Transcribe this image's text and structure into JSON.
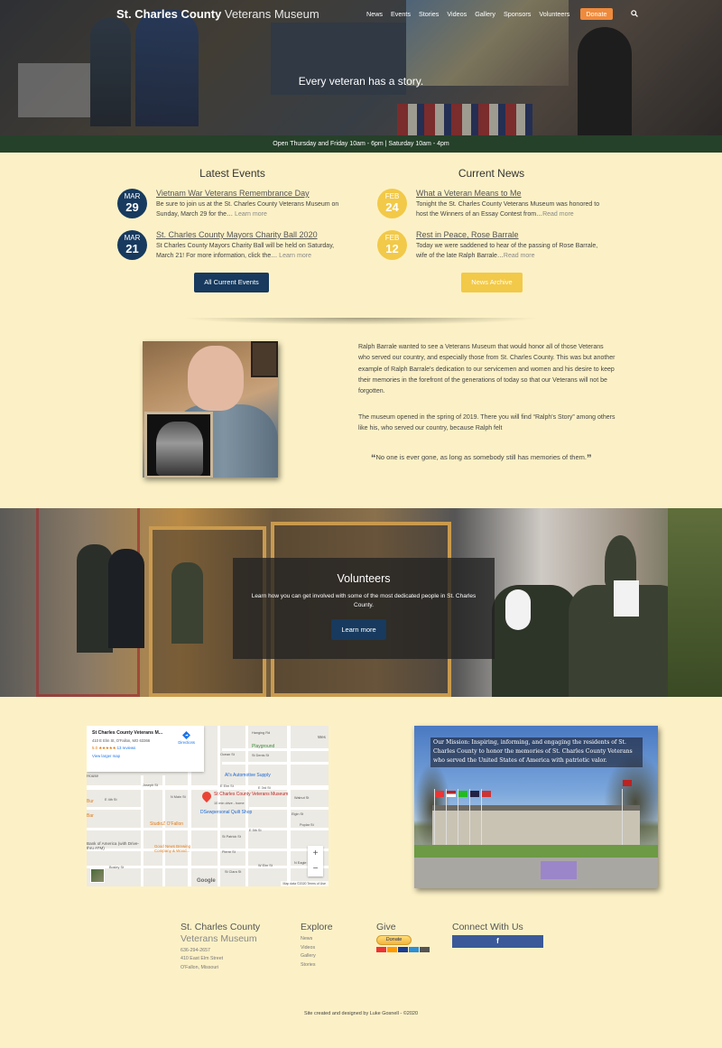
{
  "header": {
    "brand_bold": "St. Charles County",
    "brand_light": "Veterans Museum",
    "nav": [
      "News",
      "Events",
      "Stories",
      "Videos",
      "Gallery",
      "Sponsors",
      "Volunteers"
    ],
    "donate": "Donate",
    "search_icon": "search-icon",
    "tagline": "Every veteran has a story.",
    "hours": "Open Thursday and Friday 10am - 6pm | Saturday 10am - 4pm"
  },
  "events": {
    "title": "Latest Events",
    "items": [
      {
        "month": "MAR",
        "day": "29",
        "title": "Vietnam War Veterans Remembrance Day",
        "text": "Be sure to join us at the St. Charles County Veterans Museum on Sunday, March 29 for the…",
        "more": "Learn more"
      },
      {
        "month": "MAR",
        "day": "21",
        "title": "St. Charles County Mayors Charity Ball 2020",
        "text": "St Charles County Mayors Charity Ball will be held on Saturday, March 21! For more information, click the…",
        "more": "Learn more"
      }
    ],
    "button": "All Current Events"
  },
  "news": {
    "title": "Current News",
    "items": [
      {
        "month": "FEB",
        "day": "24",
        "title": "What a Veteran Means to Me",
        "text": "Tonight the St. Charles County Veterans Museum was honored to host the Winners of an Essay Contest from…",
        "more": "Read more"
      },
      {
        "month": "FEB",
        "day": "12",
        "title": "Rest in Peace, Rose Barrale",
        "text": "Today we were saddened to hear of the passing of Rose Barrale, wife of the late Ralph Barrale…",
        "more": "Read more"
      }
    ],
    "button": "News Archive"
  },
  "about": {
    "p1": "Ralph Barrale wanted to see a Veterans Museum that would honor all of those Veterans who served our country, and especially those from St. Charles County. This was but another example of Ralph Barrale's dedication to our servicemen and women and his desire to keep their memories in the forefront of the generations of today so that our Veterans will not be forgotten.",
    "p2": "The museum opened in the spring of 2019. There you will find “Ralph's Story” among others like his, who served our country, because Ralph felt",
    "quote": "No one is ever gone, as long as somebody still has memories of them."
  },
  "volunteers": {
    "title": "Volunteers",
    "text": "Learn how you can get involved with some of the most dedicated people in St. Charles County.",
    "button": "Learn more"
  },
  "map": {
    "name": "St Charles County Veterans M...",
    "address": "410 E Elm St, O'Fallon, MO 63366",
    "rating": "5.0",
    "stars": "★★★★★",
    "reviews": "13 reviews",
    "larger": "View larger map",
    "directions": "Directions",
    "labels": {
      "playground": "Playground",
      "al": "Al's Automotive Supply",
      "marker": "St Charles County Veterans Museum",
      "marker_sub": "10 min drive - home",
      "quilt": "DSewpersonal Quilt Shop",
      "studio": "StudioZ O'Fallon",
      "bank": "Bank of America (with Drive-thru ATM)",
      "brewing": "Good News Brewing Company & Wood...",
      "house": "House",
      "bar": "Bar",
      "bur": "Bur",
      "elm": "E Elm St",
      "main": "N Main St",
      "joseph": "Joseph St",
      "third": "E 3rd St",
      "fourth": "E 4th St",
      "fifth": "E 5th St",
      "dtomas": "N Eagle St",
      "walnut": "Walnut St",
      "stdenis": "St Denis St",
      "ocean": "Ocean St",
      "elgin": "Elgin St",
      "poplar": "Poplar St",
      "pierre": "Pierre St",
      "patrick": "St Patrick St",
      "hanging": "Hanging Rd",
      "stclara": "St Clara St",
      "bogey": "Bosley St",
      "north": "W Elm St",
      "westfield": "Wes"
    },
    "footer": "Map data ©2020   Terms of Use",
    "google": "Google"
  },
  "mission": {
    "text": "Our Mission: Inspiring, informing, and engaging the residents of St. Charles County to honor the memories of St. Charles County Veterans who served the United States of America with patriotic valor."
  },
  "footer": {
    "org": "St. Charles County",
    "org_sub": "Veterans Museum",
    "phone": "636-294-2657",
    "street": "410 East Elm Street",
    "city": "O'Fallon, Missouri",
    "explore_title": "Explore",
    "explore": [
      "News",
      "Videos",
      "Gallery",
      "Stories"
    ],
    "give_title": "Give",
    "paypal": "Donate",
    "connect_title": "Connect With Us",
    "fb_icon": "facebook-icon",
    "credit_pre": "Site created and designed by",
    "credit_name": "Luke Gosnell",
    "credit_post": "- ©2020"
  },
  "colors": {
    "navy": "#173a5e",
    "gold": "#f2c948",
    "orange": "#ef8a3c",
    "page_bg": "#fcf1c6",
    "hours_bar": "#26412a"
  }
}
